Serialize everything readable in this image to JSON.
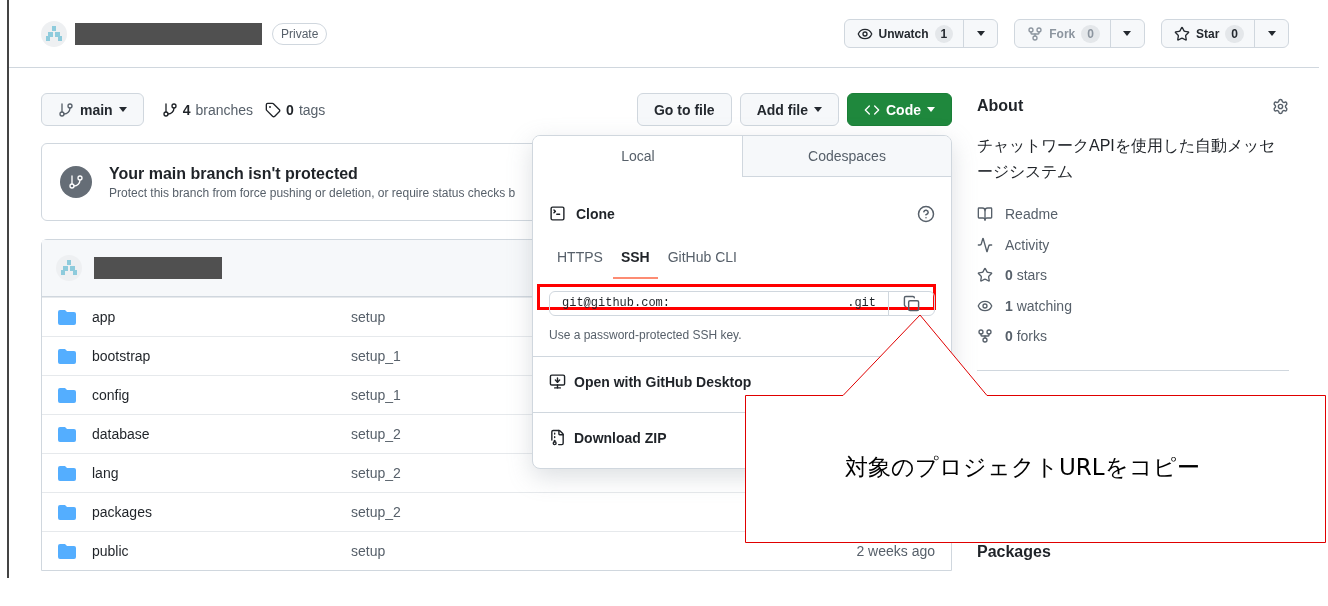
{
  "repo_header": {
    "visibility": "Private",
    "actions": [
      {
        "kind": "watch",
        "label": "Unwatch",
        "count": "1",
        "disabled": false
      },
      {
        "kind": "fork",
        "label": "Fork",
        "count": "0",
        "disabled": true
      },
      {
        "kind": "star",
        "label": "Star",
        "count": "0",
        "disabled": false
      }
    ]
  },
  "toolbar": {
    "branch": "main",
    "branches_count": "4",
    "branches_label": "branches",
    "tags_count": "0",
    "tags_label": "tags",
    "buttons": [
      {
        "kind": "plain",
        "label": "Go to file"
      },
      {
        "kind": "menu",
        "label": "Add file"
      },
      {
        "kind": "code",
        "label": "Code"
      }
    ]
  },
  "protection_notice": {
    "title": "Your main branch isn't protected",
    "text": "Protect this branch from force pushing or deletion, or require status checks b"
  },
  "files": [
    {
      "name": "app",
      "message": "setup"
    },
    {
      "name": "bootstrap",
      "message": "setup_1"
    },
    {
      "name": "config",
      "message": "setup_1"
    },
    {
      "name": "database",
      "message": "setup_2"
    },
    {
      "name": "lang",
      "message": "setup_2"
    },
    {
      "name": "packages",
      "message": "setup_2"
    },
    {
      "name": "public",
      "message": "setup",
      "age": "2 weeks ago"
    }
  ],
  "about": {
    "title": "About",
    "description": "チャットワークAPIを使用した自動メッセージシステム",
    "links": [
      {
        "kind": "readme",
        "label": "Readme"
      },
      {
        "kind": "activity",
        "label": "Activity"
      },
      {
        "kind": "stars",
        "count": "0",
        "label": "stars"
      },
      {
        "kind": "watching",
        "count": "1",
        "label": "watching"
      },
      {
        "kind": "forks",
        "count": "0",
        "label": "forks"
      }
    ],
    "packages_title": "Packages"
  },
  "clone_menu": {
    "tabs": [
      {
        "label": "Local",
        "selected": true
      },
      {
        "label": "Codespaces",
        "selected": false
      }
    ],
    "title": "Clone",
    "protocols": [
      {
        "label": "HTTPS",
        "selected": false
      },
      {
        "label": "SSH",
        "selected": true
      },
      {
        "label": "GitHub CLI",
        "selected": false
      }
    ],
    "url_prefix": "git@github.com:",
    "url_suffix": ".git",
    "hint": "Use a password-protected SSH key.",
    "actions": [
      {
        "kind": "desktop",
        "label": "Open with GitHub Desktop"
      },
      {
        "kind": "zip",
        "label": "Download ZIP"
      }
    ]
  },
  "callout": {
    "text": "対象のプロジェクトURLをコピー"
  }
}
